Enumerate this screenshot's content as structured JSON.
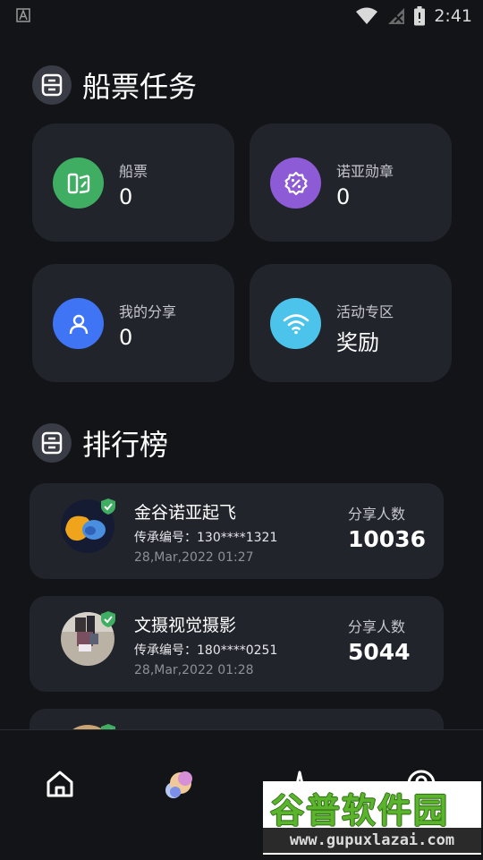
{
  "status_bar": {
    "time": "2:41"
  },
  "task_section": {
    "title": "船票任务",
    "cards": [
      {
        "label": "船票",
        "value": "0",
        "icon": "ticket-icon",
        "color": "#3fae62"
      },
      {
        "label": "诺亚勋章",
        "value": "0",
        "icon": "badge-gear-icon",
        "color": "#8e5bd6"
      },
      {
        "label": "我的分享",
        "value": "0",
        "icon": "user-icon",
        "color": "#3f74f5"
      },
      {
        "label": "活动专区",
        "value": "奖励",
        "icon": "wifi-icon",
        "color": "#4cc3eb"
      }
    ]
  },
  "ranking": {
    "title": "排行榜",
    "share_label": "分享人数",
    "items": [
      {
        "name": "金谷诺亚起飞",
        "code": "传承编号：130****1321",
        "time": "28,Mar,2022 01:27",
        "count": "10036"
      },
      {
        "name": "文摄视觉摄影",
        "code": "传承编号：180****0251",
        "time": "28,Mar,2022 01:28",
        "count": "5044"
      }
    ]
  },
  "bottom_nav": {
    "items": [
      {
        "icon": "home-icon"
      },
      {
        "icon": "planet-icon"
      },
      {
        "icon": "activity-icon"
      },
      {
        "icon": "profile-icon"
      }
    ]
  },
  "watermark": {
    "title": "谷普软件园",
    "url": "www.gupuxlazai.com"
  },
  "colors": {
    "background": "#131418",
    "card": "#22242c",
    "verified": "#3fae62"
  }
}
